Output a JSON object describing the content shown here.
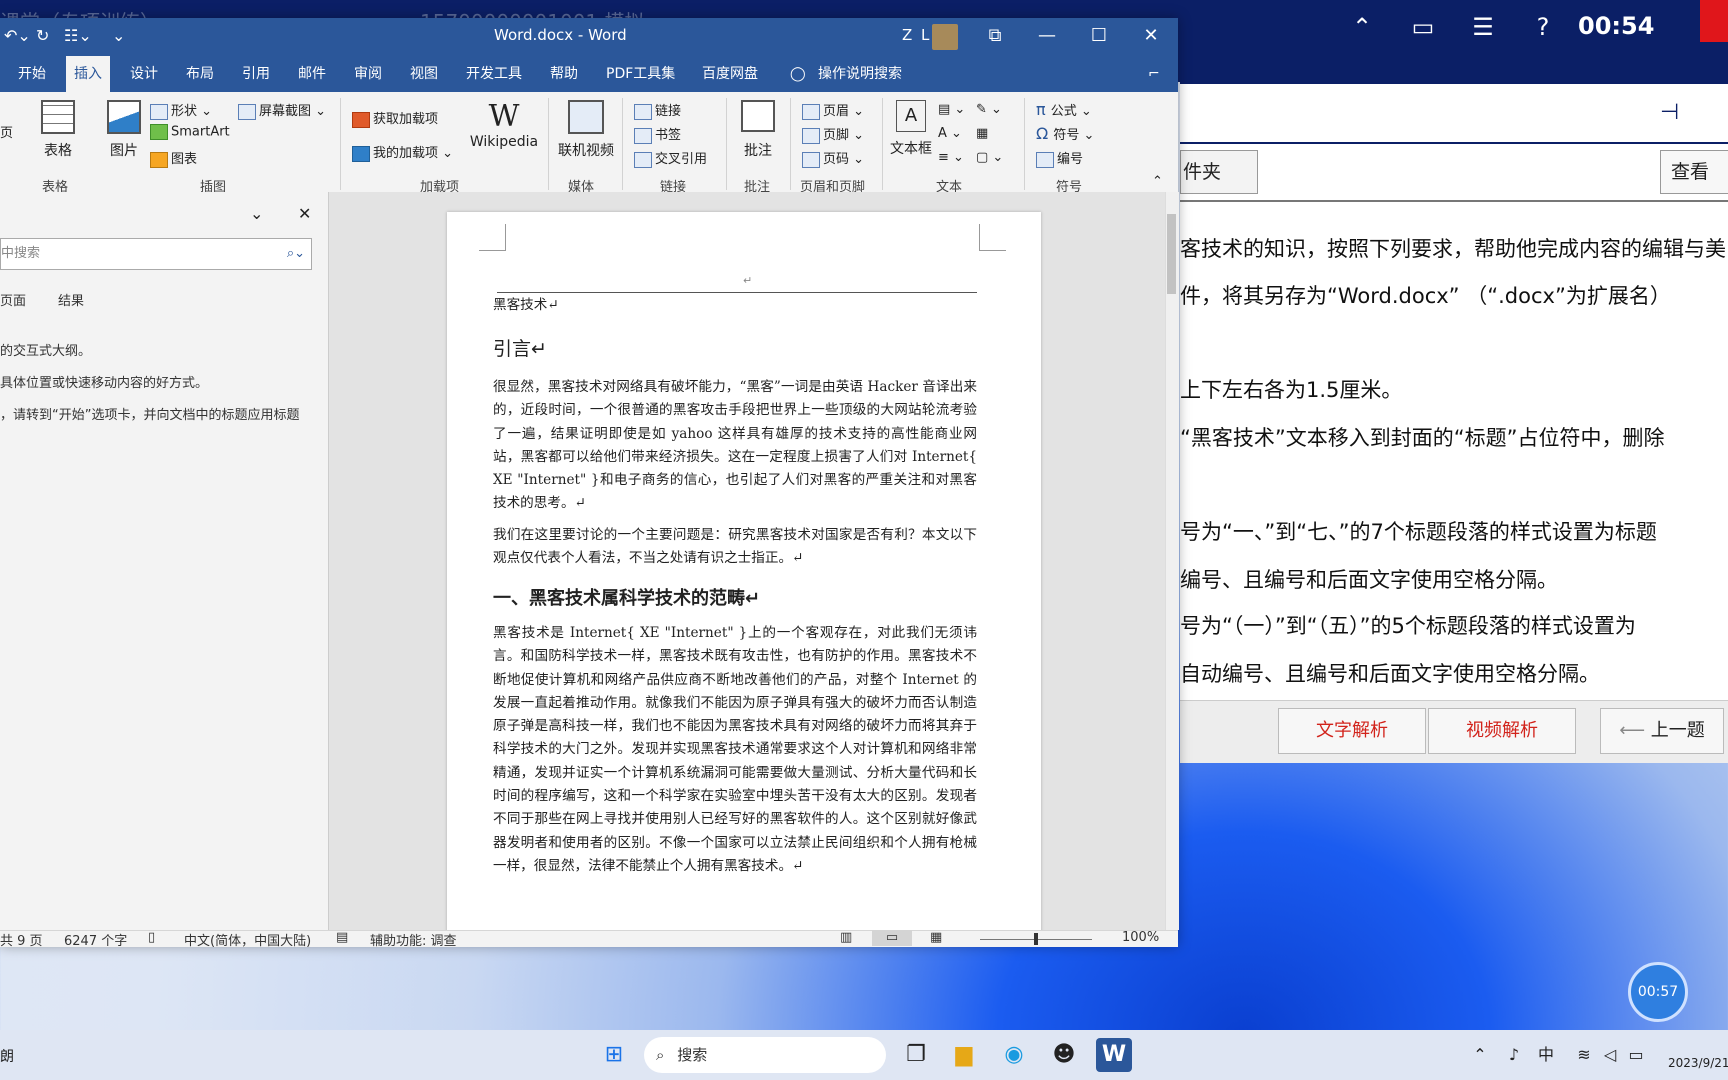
{
  "exam": {
    "faded_title": "课堂（专项训练）",
    "faded_user": "15700000001001 模拟",
    "clock": "00:54",
    "folder_label": "件夹",
    "view_label": "查看",
    "questions": [
      "客技术的知识，按照下列要求，帮助他完成内容的编辑与美",
      "件，将其另存为“Word.docx” （“.docx”为扩展名）",
      "上下左右各为1.5厘米。",
      "“黑客技术”文本移入到封面的“标题”占位符中，删除",
      "号为“一、”到“七、”的7个标题段落的样式设置为标题",
      "编号、且编号和后面文字使用空格分隔。",
      "号为“（一）”到“（五）”的5个标题段落的样式设置为",
      "自动编号、且编号和后面文字使用空格分隔。"
    ],
    "btn_text_analysis": "文字解析",
    "btn_video_analysis": "视频解析",
    "btn_prev": "上一题",
    "timer": "00:57"
  },
  "word": {
    "title": "Word.docx  -  Word",
    "user": "Z L",
    "tabs": [
      "开始",
      "插入",
      "设计",
      "布局",
      "引用",
      "邮件",
      "审阅",
      "视图",
      "开发工具",
      "帮助",
      "PDF工具集",
      "百度网盘"
    ],
    "active_tab": "插入",
    "tell_me": "操作说明搜索",
    "ribbon": {
      "table": "表格",
      "picture": "图片",
      "shapes": "形状",
      "smartart": "SmartArt",
      "chart": "图表",
      "screenshot": "屏幕截图",
      "get_addins": "获取加载项",
      "my_addins": "我的加载项",
      "wikipedia": "Wikipedia",
      "online_video": "联机视频",
      "link": "链接",
      "bookmark": "书签",
      "cross_ref": "交叉引用",
      "comment": "批注",
      "header": "页眉",
      "footer": "页脚",
      "page_number": "页码",
      "textbox": "文本框",
      "equation": "公式",
      "symbol": "符号",
      "numbering": "编号",
      "groups": [
        "表格",
        "插图",
        "加载项",
        "媒体",
        "链接",
        "批注",
        "页眉和页脚",
        "文本",
        "符号"
      ],
      "left_cut": "页"
    },
    "nav": {
      "search_placeholder": "中搜索",
      "tabs": [
        "页面",
        "结果"
      ],
      "lines": [
        "的交互式大纲。",
        "具体位置或快速移动内容的好方式。",
        "，请转到“开始”选项卡，并向文档中的标题应用标题"
      ]
    },
    "doc": {
      "header_text": "黑客技术↵",
      "intro_heading": "引言↵",
      "para1": "很显然，黑客技术对网络具有破坏能力，“黑客”一词是由英语 Hacker 音译出来的，近段时间，一个很普通的黑客攻击手段把世界上一些顶级的大网站轮流考验了一遍，结果证明即使是如 yahoo 这样具有雄厚的技术支持的高性能商业网站，黑客都可以给他们带来经济损失。这在一定程度上损害了人们对 Internet{ XE \"Internet\" }和电子商务的信心，也引起了人们对黑客的严重关注和对黑客技术的思考。↵",
      "para2": "我们在这里要讨论的一个主要问题是：研究黑客技术对国家是否有利？本文以下观点仅代表个人看法，不当之处请有识之士指正。↵",
      "section1_heading": "一、黑客技术属科学技术的范畴↵",
      "para3": "黑客技术是 Internet{ XE \"Internet\" }上的一个客观存在，对此我们无须讳言。和国防科学技术一样，黑客技术既有攻击性，也有防护的作用。黑客技术不断地促使计算机和网络产品供应商不断地改善他们的产品，对整个 Internet 的发展一直起着推动作用。就像我们不能因为原子弹具有强大的破坏力而否认制造原子弹是高科技一样，我们也不能因为黑客技术具有对网络的破坏力而将其弃于科学技术的大门之外。发现并实现黑客技术通常要求这个人对计算机和网络非常精通，发现并证实一个计算机系统漏洞可能需要做大量测试、分析大量代码和长时间的程序编写，这和一个科学家在实验室中埋头苦干没有太大的区别。发现者不同于那些在网上寻找并使用别人已经写好的黑客软件的人。这个区别就好像武器发明者和使用者的区别。不像一个国家可以立法禁止民间组织和个人拥有枪械一样，很显然，法律不能禁止个人拥有黑客技术。↵"
    },
    "status": {
      "pages": "共 9 页",
      "words": "6247 个字",
      "language": "中文(简体，中国大陆)",
      "accessibility": "辅助功能: 调查",
      "zoom": "100%"
    }
  },
  "taskbar": {
    "search_placeholder": "搜索",
    "ime": "中",
    "date": "2023/9/21",
    "left_cut": "朗"
  }
}
